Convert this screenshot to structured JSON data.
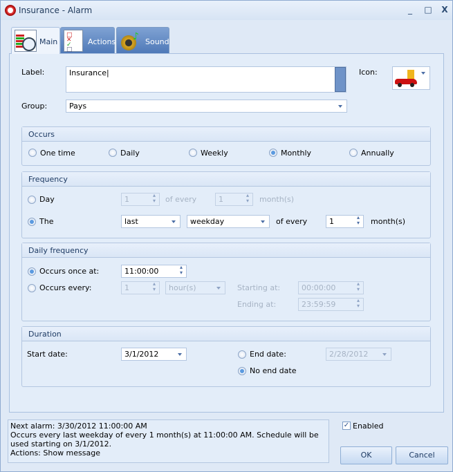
{
  "window": {
    "title": "Insurance - Alarm",
    "minimize": "_",
    "maximize": "□",
    "close": "X"
  },
  "tabs": [
    {
      "label": "Main",
      "icon": "calendar-clock-icon"
    },
    {
      "label": "Actions",
      "icon": "checklist-icon"
    },
    {
      "label": "Sound",
      "icon": "speaker-icon"
    }
  ],
  "main": {
    "label_label": "Label:",
    "label_value": "Insurance",
    "icon_label": "Icon:",
    "icon_value": "car-coins-icon",
    "group_label": "Group:",
    "group_value": "Pays",
    "occurs": {
      "title": "Occurs",
      "options": [
        "One time",
        "Daily",
        "Weekly",
        "Monthly",
        "Annually"
      ],
      "selected": "Monthly"
    },
    "frequency": {
      "title": "Frequency",
      "day_label": "Day",
      "day_value": "1",
      "of_every": "of every",
      "day_months": "1",
      "months": "month(s)",
      "the_label": "The",
      "which": "last",
      "weekday": "weekday",
      "the_months": "1",
      "selected": "The"
    },
    "daily": {
      "title": "Daily frequency",
      "once_label": "Occurs once at:",
      "once_value": "11:00:00",
      "every_label": "Occurs every:",
      "every_value": "1",
      "every_unit": "hour(s)",
      "starting_label": "Starting at:",
      "starting_value": "00:00:00",
      "ending_label": "Ending at:",
      "ending_value": "23:59:59",
      "selected": "once"
    },
    "duration": {
      "title": "Duration",
      "start_label": "Start date:",
      "start_value": "3/1/2012",
      "end_label": "End date:",
      "end_value": "2/28/2012",
      "no_end_label": "No end date",
      "selected": "no_end"
    }
  },
  "summary": {
    "line1": "Next alarm: 3/30/2012 11:00:00 AM",
    "line2": "Occurs every last weekday of every 1 month(s) at 11:00:00 AM. Schedule will be used starting on 3/1/2012.",
    "line3": "Actions: Show message"
  },
  "enabled": {
    "label": "Enabled",
    "checked": true
  },
  "buttons": {
    "ok": "OK",
    "cancel": "Cancel"
  }
}
